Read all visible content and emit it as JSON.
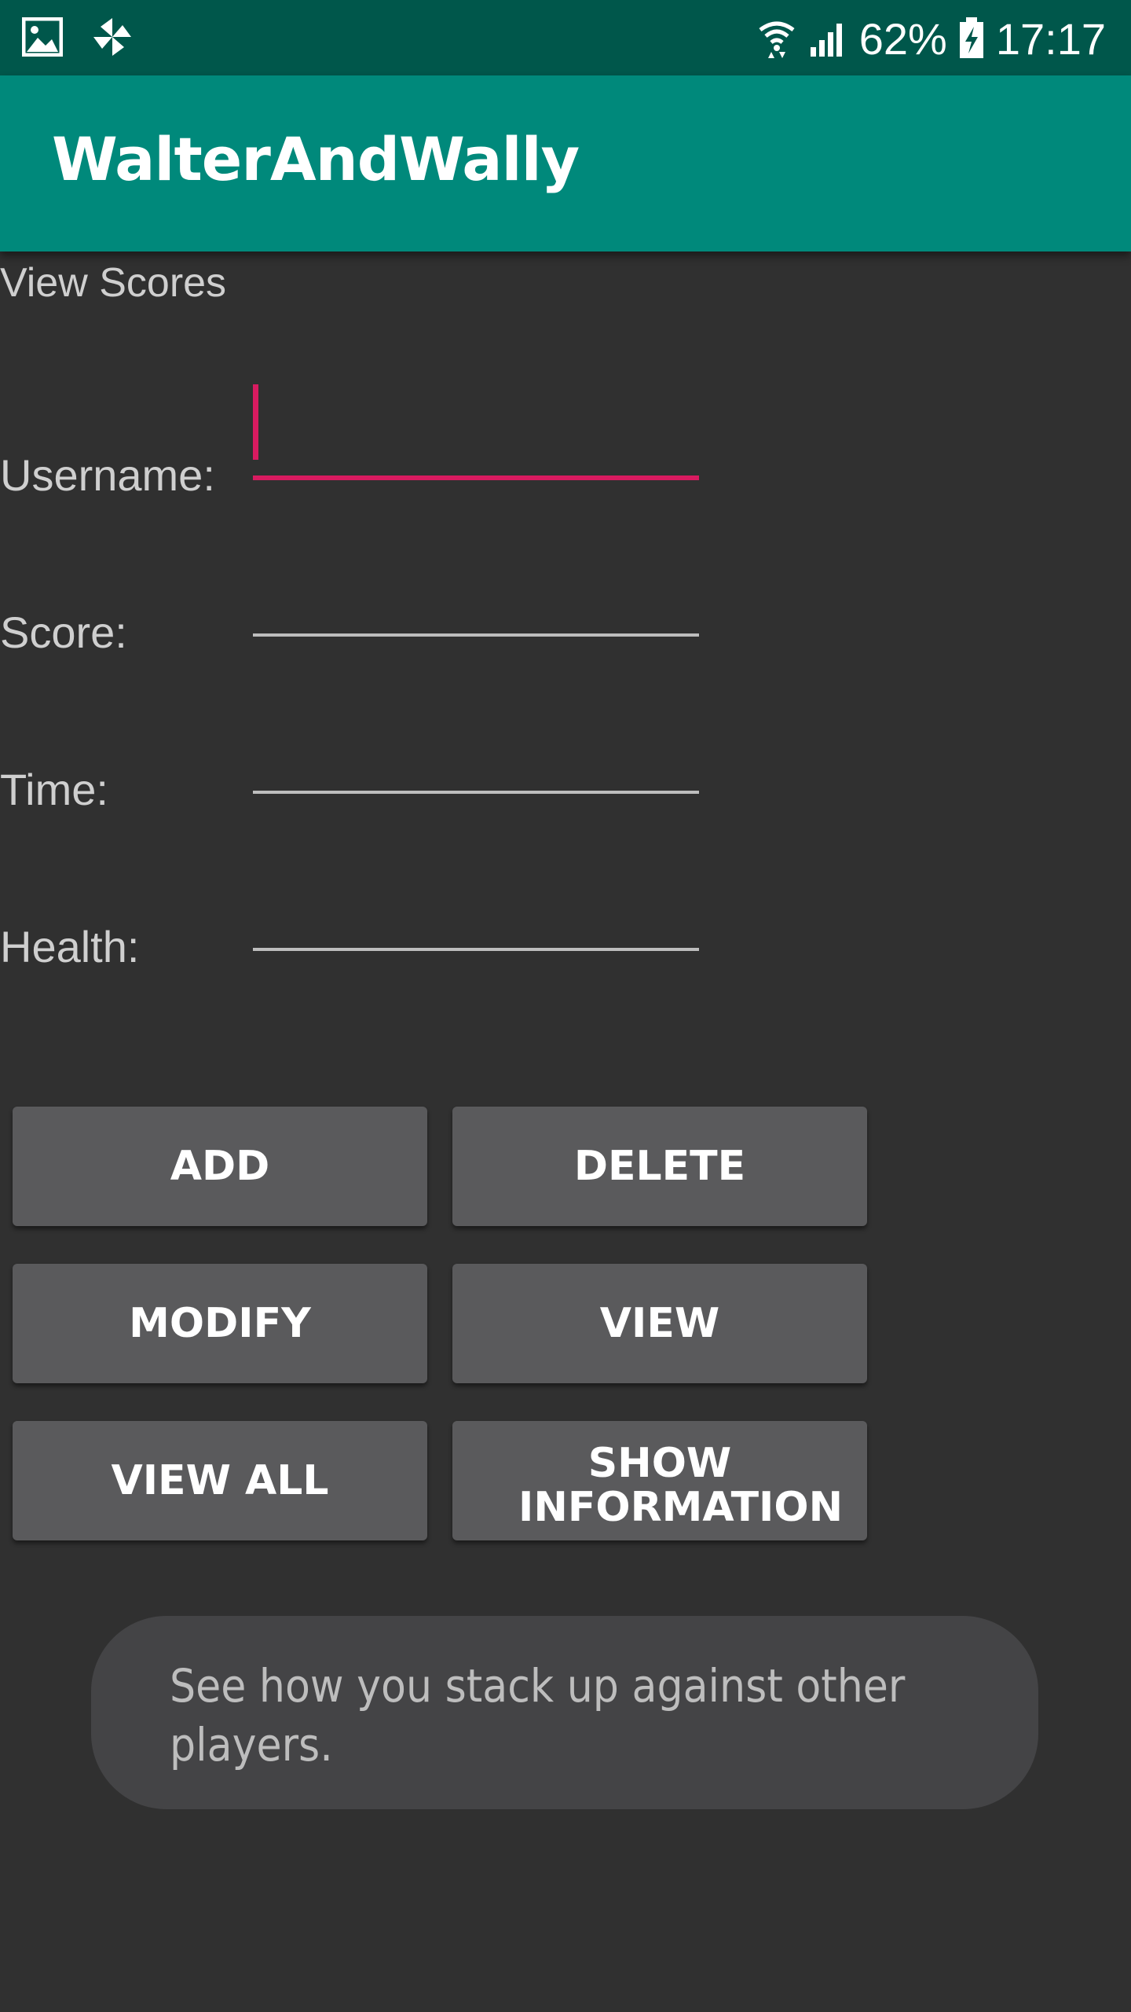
{
  "status_bar": {
    "icons_left": [
      "image-notification-icon",
      "pinwheel-notification-icon"
    ],
    "icons_right": [
      "wifi-icon",
      "cell-signal-icon",
      "battery-charging-icon"
    ],
    "battery": "62%",
    "time": "17:17"
  },
  "app_bar": {
    "title": "WalterAndWally"
  },
  "screen": {
    "title": "View Scores"
  },
  "form": {
    "username_label": "Username:",
    "username_value": "",
    "score_label": "Score:",
    "score_value": "",
    "time_label": "Time:",
    "time_value": "",
    "health_label": "Health:",
    "health_value": ""
  },
  "buttons": {
    "add": "ADD",
    "delete": "DELETE",
    "modify": "MODIFY",
    "view": "VIEW",
    "view_all": "VIEW ALL",
    "show_information": "SHOW INFORMATION"
  },
  "toast": {
    "message": "See how you stack up against other players."
  },
  "colors": {
    "status_bar": "#00574b",
    "app_bar": "#00897b",
    "background": "#303030",
    "accent": "#d81b60",
    "button": "#5a5a5c"
  }
}
